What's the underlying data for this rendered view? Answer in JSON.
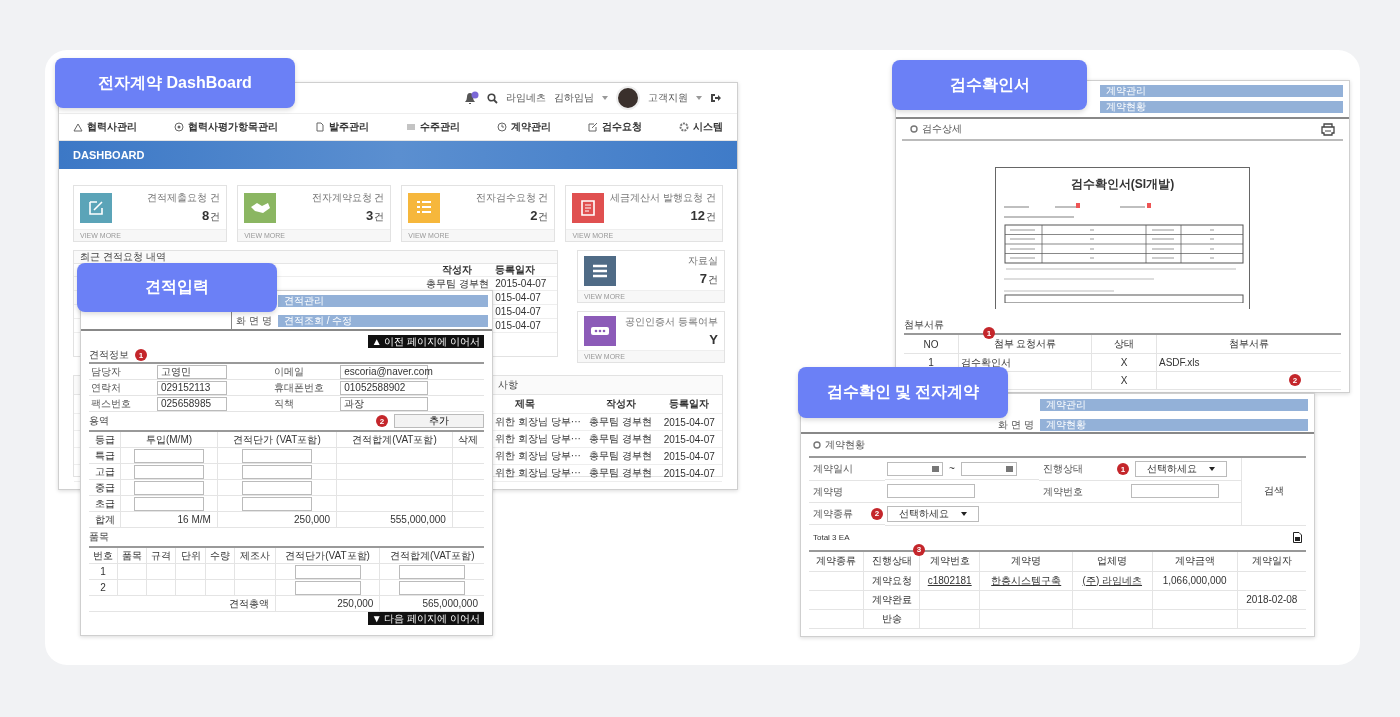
{
  "dashboard": {
    "caption": "전자계약 DashBoard",
    "company": "라임네츠",
    "user": "김하임님",
    "support": "고객지원",
    "nav": [
      "협력사관리",
      "협력사평가항목관리",
      "발주관리",
      "수주관리",
      "계약관리",
      "검수요청",
      "시스템"
    ],
    "banner": "DASHBOARD",
    "stats": [
      {
        "title": "견적제출요청 건",
        "count": "8",
        "unit": "건",
        "more": "VIEW MORE",
        "color": "#5ba4b8"
      },
      {
        "title": "전자계약요청 건",
        "count": "3",
        "unit": "건",
        "more": "VIEW MORE",
        "color": "#8bb662"
      },
      {
        "title": "전자검수요청 건",
        "count": "2",
        "unit": "건",
        "more": "VIEW MORE",
        "color": "#f6b73c"
      },
      {
        "title": "세금계산서 발행요청 건",
        "count": "12",
        "unit": "건",
        "more": "VIEW MORE",
        "color": "#e05050"
      }
    ],
    "side": [
      {
        "title": "자료실",
        "value": "7",
        "unit": "건",
        "more": "VIEW MORE",
        "color": "#4f6b86"
      },
      {
        "title": "공인인증서 등록여부",
        "value": "Y",
        "more": "VIEW MORE",
        "color": "#8c5bb8"
      }
    ],
    "recent": {
      "title": "최근 견적요청 내역",
      "columns": [
        "작성자",
        "등록일자"
      ],
      "rows": [
        {
          "writer": "총무팀 경부현",
          "date": "2015-04-07"
        },
        {
          "date": "015-04-07"
        },
        {
          "date": "015-04-07"
        },
        {
          "date": "015-04-07"
        }
      ]
    },
    "notice": {
      "title": "사항",
      "columns": [
        "제목",
        "작성자",
        "등록일자"
      ],
      "rows": [
        {
          "subject": "위한 회장님 당부···",
          "writer": "총무팀 경부현",
          "date": "2015-04-07"
        },
        {
          "subject": "위한 회장님 당부···",
          "writer": "총무팀 경부현",
          "date": "2015-04-07"
        },
        {
          "subject": "위한 회장님 당부···",
          "writer": "총무팀 경부현",
          "date": "2015-04-07"
        },
        {
          "subject": "위한 회장님 당부···",
          "writer": "총무팀 경부현",
          "date": "2015-04-07"
        }
      ]
    }
  },
  "estimate": {
    "caption": "견적입력",
    "menu": "견적관리",
    "screen_label": "화 면 명",
    "screen": "견적조회 / 수정",
    "prev_button": "▲ 이전 페이지에 이어서",
    "info": {
      "title": "견적정보",
      "badge": "1",
      "rows": [
        {
          "label": "담당자",
          "value": "고영민",
          "label2": "이메일",
          "value2": "escoria@naver.com"
        },
        {
          "label": "연락처",
          "value": "029152113",
          "label2": "휴대폰번호",
          "value2": "01052588902"
        },
        {
          "label": "팩스번호",
          "value": "025658985",
          "label2": "직책",
          "value2": "과장"
        }
      ]
    },
    "service": {
      "title": "용역",
      "badge": "2",
      "add_button": "추가",
      "columns": [
        "등급",
        "투입(M/M)",
        "견적단가 (VAT포함)",
        "견적합계(VAT포함)",
        "삭제"
      ],
      "rows": [
        "특급",
        "고급",
        "중급",
        "초급"
      ],
      "total": {
        "label": "합계",
        "mm": "16 M/M",
        "price": "250,000",
        "sum": "555,000,000"
      }
    },
    "items": {
      "title": "품목",
      "columns": [
        "번호",
        "품목",
        "규격",
        "단위",
        "수량",
        "제조사",
        "견적단가(VAT포함)",
        "견적합계(VAT포함)"
      ],
      "rows": [
        "1",
        "2"
      ],
      "total": {
        "label": "견적총액",
        "price": "250,000",
        "sum": "565,000,000"
      }
    },
    "next_button": "▼ 다음 페이지에 이어서"
  },
  "inspection": {
    "caption": "검수확인서",
    "menu": "계약관리",
    "screen": "계약현황",
    "section": "검수상세",
    "document_title": "검수확인서(SI개발)",
    "attachments": {
      "title": "첨부서류",
      "badge": "1",
      "columns": [
        "NO",
        "첨부 요청서류",
        "상태",
        "첨부서류"
      ],
      "rows": [
        {
          "no": "1",
          "name": "검수확인서",
          "status": "X",
          "file": "ASDF.xls"
        },
        {
          "status": "X",
          "badge": "2"
        }
      ]
    }
  },
  "contract": {
    "caption": "검수확인 및 전자계약",
    "menu": "계약관리",
    "screen_label": "화 면 명",
    "screen": "계약현황",
    "section": "계약현황",
    "form": {
      "date_label": "계약일시",
      "range_sep": "~",
      "status_label": "진행상태",
      "status_badge": "1",
      "status_select": "선택하세요",
      "name_label": "계약명",
      "number_label": "계약번호",
      "type_label": "계약종류",
      "type_badge": "2",
      "type_select": "선택하세요",
      "search": "검색"
    },
    "total": "Total 3 EA",
    "badge": "3",
    "columns": [
      "계약종류",
      "진행상태",
      "계약번호",
      "계약명",
      "업체명",
      "계약금액",
      "계약일자"
    ],
    "rows": [
      {
        "status": "계약요청",
        "number": "c1802181",
        "name": "한층시스템구축",
        "vendor": "(주) 라임네츠",
        "amount": "1,066,000,000"
      },
      {
        "status": "계약완료",
        "date": "2018-02-08"
      },
      {
        "status": "반송"
      }
    ]
  }
}
